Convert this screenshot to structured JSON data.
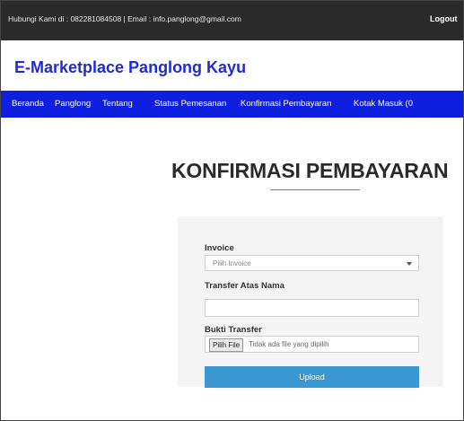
{
  "topbar": {
    "contact": "Hubungi Kami di : 082281084508 | Email : info.panglong@gmail.com",
    "logout_label": "Logout"
  },
  "brand": {
    "name": "E-Marketplace Panglong Kayu"
  },
  "nav": {
    "items": [
      "Beranda",
      "Panglong",
      "Tentang",
      "Status Pemesanan",
      "Konfirmasi Pembayaran",
      "Kotak Masuk (0"
    ]
  },
  "page": {
    "title": "KONFIRMASI PEMBAYARAN"
  },
  "form": {
    "invoice_label": "Invoice",
    "invoice_selected": "Pilih Invoice",
    "name_label": "Transfer Atas Nama",
    "name_value": "",
    "proof_label": "Bukti Transfer",
    "file_button": "Pilih File",
    "file_status": "Tidak ada file yang dipilih",
    "submit_label": "Upload"
  },
  "colors": {
    "brand": "#1f2bd8",
    "navbar": "#0f1fe0",
    "topbar": "#2b2b2b",
    "button": "#3a97d1"
  }
}
